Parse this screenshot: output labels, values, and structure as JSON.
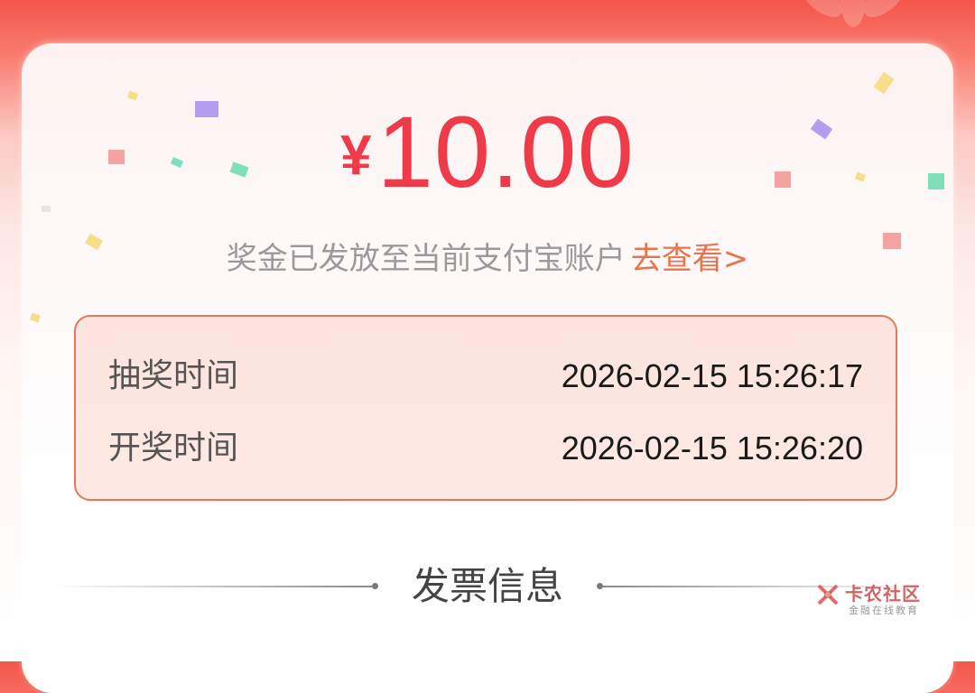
{
  "reward": {
    "currency_symbol": "¥",
    "amount": "10.00",
    "message": "奖金已发放至当前支付宝账户",
    "view_link": "去查看>"
  },
  "draw_info": {
    "rows": [
      {
        "label": "抽奖时间",
        "value": "2026-02-15 15:26:17"
      },
      {
        "label": "开奖时间",
        "value": "2026-02-15 15:26:20"
      }
    ]
  },
  "invoice_section": {
    "title": "发票信息"
  },
  "watermark": {
    "title": "卡农社区",
    "subtitle": "金融在线教育"
  },
  "colors": {
    "accent_red": "#ef3a4a",
    "link_orange": "#e8744d",
    "box_border": "#e07a5a",
    "box_fill": "#fde4de"
  }
}
